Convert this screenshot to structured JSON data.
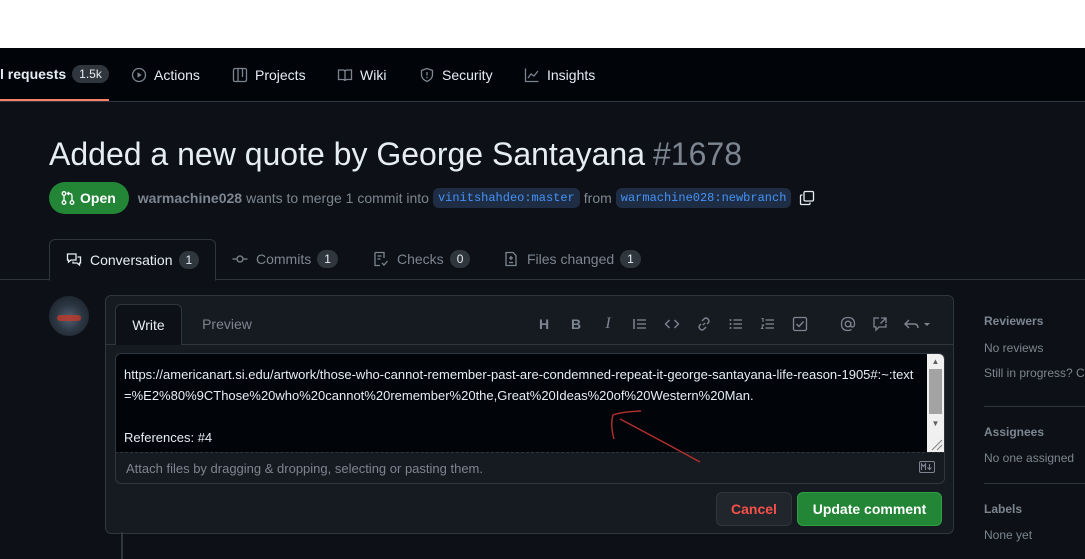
{
  "repo_nav": {
    "items": [
      {
        "label": "l requests",
        "count": "1.5k",
        "icon": "git-pull-request-icon",
        "active": true
      },
      {
        "label": "Actions",
        "icon": "play-icon"
      },
      {
        "label": "Projects",
        "icon": "table-icon"
      },
      {
        "label": "Wiki",
        "icon": "book-icon"
      },
      {
        "label": "Security",
        "icon": "shield-icon"
      },
      {
        "label": "Insights",
        "icon": "graph-icon"
      }
    ]
  },
  "pr": {
    "title": "Added a new quote by George Santayana",
    "number": "#1678",
    "state": "Open",
    "author": "warmachine028",
    "merge_text": "wants to merge 1 commit into",
    "base_branch": "vinitshahdeo:master",
    "from_text": "from",
    "head_branch": "warmachine028:newbranch"
  },
  "tabs": [
    {
      "label": "Conversation",
      "count": "1",
      "icon": "comment-discussion-icon"
    },
    {
      "label": "Commits",
      "count": "1",
      "icon": "git-commit-icon"
    },
    {
      "label": "Checks",
      "count": "0",
      "icon": "checklist-icon"
    },
    {
      "label": "Files changed",
      "count": "1",
      "icon": "file-diff-icon"
    }
  ],
  "editor": {
    "write_tab": "Write",
    "preview_tab": "Preview",
    "toolbar": [
      "heading-icon",
      "bold-icon",
      "italic-icon",
      "quote-icon",
      "code-icon",
      "link-icon",
      "unordered-list-icon",
      "ordered-list-icon",
      "tasklist-icon",
      "mention-icon",
      "cross-reference-icon",
      "reply-icon"
    ],
    "toolbar_glyphs": {
      "heading": "H",
      "bold": "B",
      "italic": "I"
    },
    "body_line1": "https://americanart.si.edu/artwork/those-who-cannot-remember-past-are-condemned-repeat-it-george-santayana-life-reason-1905#:~:text=%E2%80%9CThose%20who%20cannot%20remember%20the,Great%20Ideas%20of%20Western%20Man.",
    "body_line2": "References: #4",
    "attach_text": "Attach files by dragging & dropping, selecting or pasting them.",
    "cancel_label": "Cancel",
    "update_label": "Update comment"
  },
  "sidebar": {
    "reviewers_heading": "Reviewers",
    "reviewers_value": "No reviews",
    "reviewers_progress": "Still in progress? Co",
    "assignees_heading": "Assignees",
    "assignees_value": "No one assigned",
    "labels_heading": "Labels",
    "labels_value": "None yet"
  },
  "colors": {
    "background": "#0d1117",
    "open_green": "#238636",
    "accent_blue": "#4493f8",
    "danger_red": "#f85149",
    "annotation_red": "#b3302d"
  }
}
